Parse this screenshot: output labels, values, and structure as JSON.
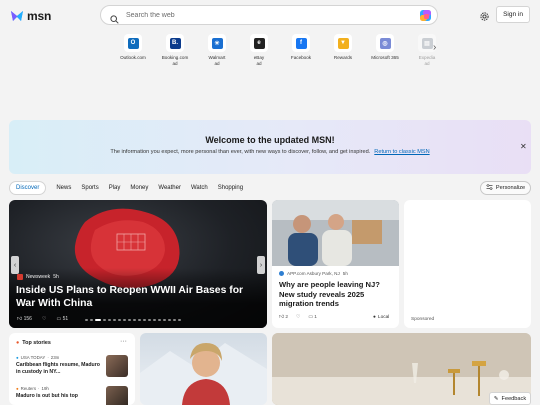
{
  "brand": {
    "name": "msn"
  },
  "search": {
    "placeholder": "Search the web"
  },
  "header": {
    "signin_label": "Sign in"
  },
  "quick_links": [
    {
      "label": "Outlook.com",
      "sub": "",
      "icon": "outlook-icon",
      "color": "#0f6cbd",
      "glyph": "O"
    },
    {
      "label": "Booking.com",
      "sub": "ad",
      "icon": "booking-icon",
      "color": "#0b3b8c",
      "glyph": "B."
    },
    {
      "label": "Walmart",
      "sub": "ad",
      "icon": "walmart-icon",
      "color": "#1a6fd1",
      "glyph": "✳"
    },
    {
      "label": "eBay",
      "sub": "ad",
      "icon": "ebay-icon",
      "color": "#222222",
      "glyph": "e"
    },
    {
      "label": "Facebook",
      "sub": "",
      "icon": "facebook-icon",
      "color": "#1877f2",
      "glyph": "f"
    },
    {
      "label": "Rewards",
      "sub": "",
      "icon": "rewards-icon",
      "color": "#f2b01e",
      "glyph": "▼"
    },
    {
      "label": "Microsoft 365",
      "sub": "",
      "icon": "microsoft365-icon",
      "color": "#7a8bd6",
      "glyph": "◎"
    },
    {
      "label": "Expedia",
      "sub": "ad",
      "icon": "expedia-icon",
      "color": "#9aa3ad",
      "glyph": "▤"
    }
  ],
  "banner": {
    "title": "Welcome to the updated MSN!",
    "body": "The information you expect, more personal than ever, with new ways to discover, follow, and get inspired.",
    "link": "Return to classic MSN"
  },
  "nav": {
    "items": [
      "Discover",
      "News",
      "Sports",
      "Play",
      "Money",
      "Weather",
      "Watch",
      "Shopping"
    ],
    "personalize": "Personalize"
  },
  "hero": {
    "source": "Newsweek",
    "age": "5h",
    "title": "Inside US Plans to Reopen WWII Air Bases for War With China",
    "likes": "156",
    "comments": "51"
  },
  "nj_card": {
    "source": "APP.com Asbury Park, NJ",
    "age": "5h",
    "title": "Why are people leaving NJ? New study reveals 2025 migration trends",
    "likes": "2",
    "comments": "1",
    "tag": "Local"
  },
  "ad_card": {
    "label": "Sponsored"
  },
  "top_stories": {
    "heading": "Top stories",
    "items": [
      {
        "source": "USA TODAY",
        "age": "23m",
        "title": "Caribbean flights resume, Maduro in custody in NY..."
      },
      {
        "source": "Reuters",
        "age": "19h",
        "title": "Maduro is out but his top"
      }
    ]
  },
  "feedback": {
    "label": "Feedback"
  },
  "colors": {
    "accent": "#0067b8",
    "banner_start": "#d8eef7",
    "banner_end": "#e9dff5"
  }
}
